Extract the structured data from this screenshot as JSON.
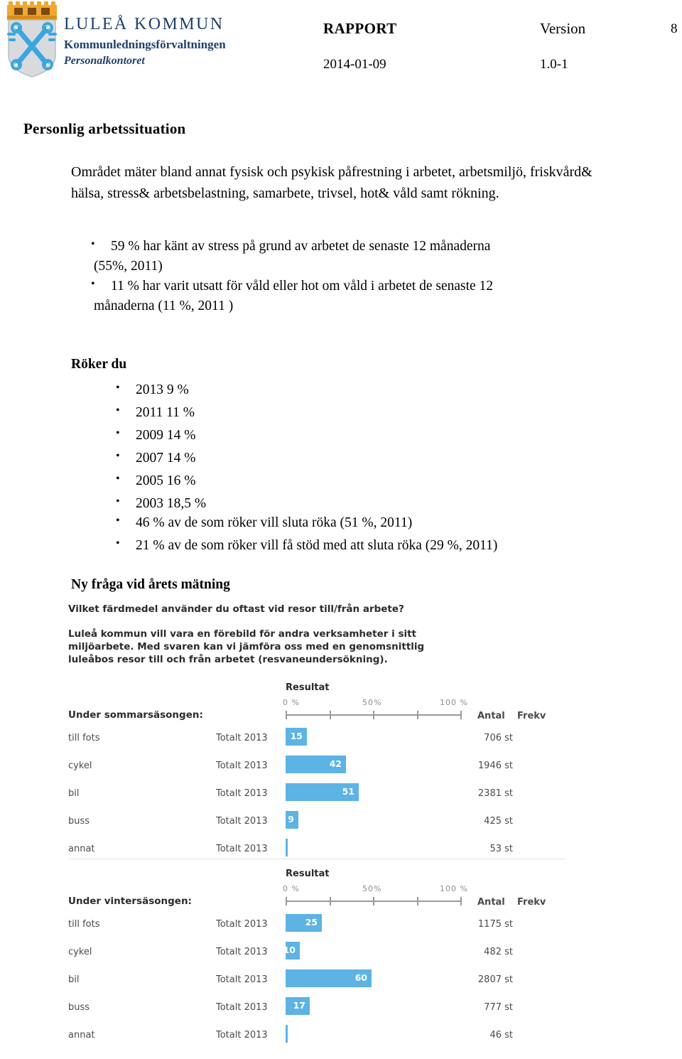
{
  "header": {
    "org_name": "LULEÅ KOMMUN",
    "org_dept": "Kommunledningsförvaltningen",
    "org_unit": "Personalkontoret",
    "doctype": "RAPPORT",
    "version_label": "Version",
    "page_number": "8",
    "date": "2014-01-09",
    "version_value": "1.0-1",
    "logo_icon": "lulea-coat-of-arms-crossed-keys-crown"
  },
  "content": {
    "section_title": "Personlig arbetssituation",
    "intro": "Området mäter bland annat fysisk och psykisk påfrestning i arbetet, arbetsmiljö, friskvård& hälsa, stress& arbetsbelastning, samarbete, trivsel, hot& våld samt rökning.",
    "stress_bullets": [
      {
        "text": "59 % har känt av stress på grund av arbetet de senaste 12 månaderna",
        "continuation": false
      },
      {
        "text": "(55%, 2011)",
        "continuation": true
      },
      {
        "text": "11 % har varit utsatt för våld eller hot om våld i arbetet de senaste 12",
        "continuation": false
      },
      {
        "text": "månaderna (11 %, 2011 )",
        "continuation": true
      }
    ],
    "roker_heading": "Röker du",
    "roker_bullets": [
      {
        "text": "2013  9 %"
      },
      {
        "text": "2011 11 %"
      },
      {
        "text": "2009 14 %"
      },
      {
        "text": "2007 14 %"
      },
      {
        "text": "2005 16 %"
      },
      {
        "text": "2003 18,5 %"
      }
    ],
    "quit_bullets": [
      {
        "text": "46 % av de som röker vill sluta röka (51 %, 2011)"
      },
      {
        "text": "21 % av de som röker vill få stöd med att sluta röka (29 %, 2011)"
      }
    ],
    "ny_fraga_heading": "Ny fråga vid årets mätning"
  },
  "survey": {
    "question": "Vilket färdmedel använder du oftast vid resor till/från arbete?",
    "blurb": "Luleå kommun vill vara en förebild för andra verksamheter i sitt miljöarbete. Med svaren kan vi jämföra oss med en genomsnittlig luleåbos resor till och från arbetet (resvaneundersökning).",
    "bar_color": "#5cb3e4",
    "axis_color": "#9a9a9a"
  },
  "chart_data": [
    {
      "type": "bar",
      "title": "Resultat",
      "subtitle": "Under sommarsäsongen:",
      "orientation": "horizontal",
      "xlabel": "",
      "ylabel": "",
      "xlim": [
        0,
        100
      ],
      "tick_labels": [
        "0 %",
        "50%",
        "100 %"
      ],
      "tick_values": [
        0,
        25,
        50,
        75,
        100
      ],
      "grid": false,
      "legend": "none",
      "columns": [
        "",
        "",
        "Resultat",
        "Antal",
        "Frekv"
      ],
      "period_label": "Totalt 2013",
      "categories": [
        "till fots",
        "cykel",
        "bil",
        "buss",
        "annat"
      ],
      "values": [
        15,
        42,
        51,
        9,
        1
      ],
      "value_labels": [
        "15",
        "42",
        "51",
        "9",
        ""
      ],
      "counts": [
        "706 st",
        "1946 st",
        "2381 st",
        "425 st",
        "53 st"
      ],
      "frekv": [
        "",
        "",
        "",
        "",
        ""
      ]
    },
    {
      "type": "bar",
      "title": "Resultat",
      "subtitle": "Under vintersäsongen:",
      "orientation": "horizontal",
      "xlabel": "",
      "ylabel": "",
      "xlim": [
        0,
        100
      ],
      "tick_labels": [
        "0 %",
        "50%",
        "100 %"
      ],
      "tick_values": [
        0,
        25,
        50,
        75,
        100
      ],
      "grid": false,
      "legend": "none",
      "columns": [
        "",
        "",
        "Resultat",
        "Antal",
        "Frekv"
      ],
      "period_label": "Totalt 2013",
      "categories": [
        "till fots",
        "cykel",
        "bil",
        "buss",
        "annat"
      ],
      "values": [
        25,
        10,
        60,
        17,
        1
      ],
      "value_labels": [
        "25",
        "10",
        "60",
        "17",
        ""
      ],
      "counts": [
        "1175 st",
        "482 st",
        "2807 st",
        "777 st",
        "46 st"
      ],
      "frekv": [
        "",
        "",
        "",
        "",
        ""
      ]
    }
  ]
}
